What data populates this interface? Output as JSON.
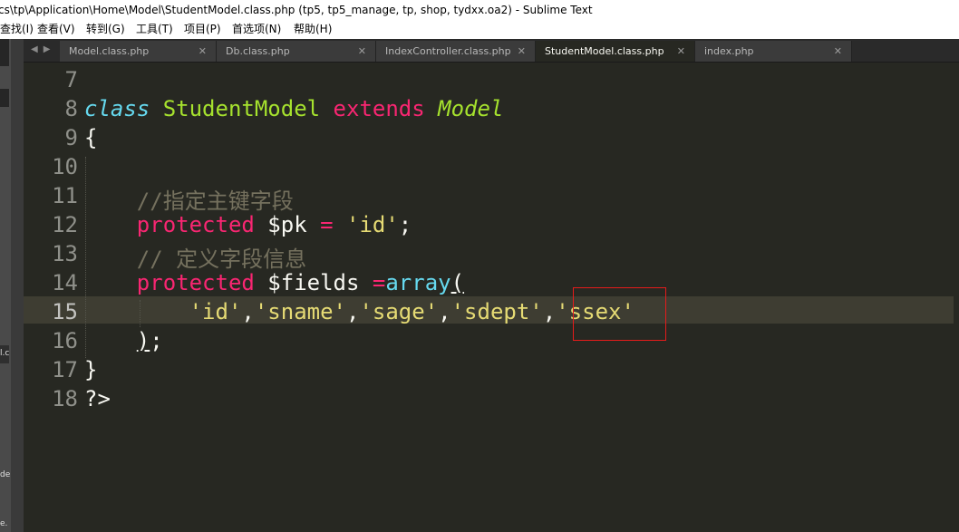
{
  "window": {
    "title": "cs\\tp\\Application\\Home\\Model\\StudentModel.class.php (tp5, tp5_manage, tp, shop, tydxx.oa2) - Sublime Text"
  },
  "menu": [
    "查找(I)",
    "查看(V)",
    "转到(G)",
    "工具(T)",
    "项目(P)",
    "首选项(N)",
    "帮助(H)"
  ],
  "tabs": [
    {
      "label": "Model.class.php",
      "active": false
    },
    {
      "label": "Db.class.php",
      "active": false
    },
    {
      "label": "IndexController.class.php",
      "active": false
    },
    {
      "label": "StudentModel.class.php",
      "active": true
    },
    {
      "label": "index.php",
      "active": false
    }
  ],
  "left_fragments": [
    "l.c",
    "de",
    "e."
  ],
  "highlight": {
    "current_line": 15,
    "box_color": "#e51b1b"
  },
  "colors": {
    "keyword": "#f92672",
    "class_kw": "#66d9ef",
    "class_name": "#a6e22e",
    "string": "#e6db74",
    "comment": "#75715e",
    "default": "#f8f8f2"
  },
  "editor": {
    "lines": [
      {
        "num": "7",
        "tokens": []
      },
      {
        "num": "8",
        "tokens": [
          {
            "t": "class",
            "c": "class_kw",
            "i": true
          },
          {
            "t": " ",
            "c": "default"
          },
          {
            "t": "StudentModel",
            "c": "class_name"
          },
          {
            "t": " ",
            "c": "default"
          },
          {
            "t": "extends",
            "c": "keyword"
          },
          {
            "t": " ",
            "c": "default"
          },
          {
            "t": "Model",
            "c": "class_name",
            "i": true
          }
        ]
      },
      {
        "num": "9",
        "tokens": [
          {
            "t": "{",
            "c": "default"
          }
        ]
      },
      {
        "num": "10",
        "tokens": []
      },
      {
        "num": "11",
        "tokens": [
          {
            "t": "    //指定主键字段",
            "c": "comment"
          }
        ]
      },
      {
        "num": "12",
        "tokens": [
          {
            "t": "    ",
            "c": "default"
          },
          {
            "t": "protected",
            "c": "keyword"
          },
          {
            "t": " $pk ",
            "c": "default"
          },
          {
            "t": "=",
            "c": "keyword"
          },
          {
            "t": " ",
            "c": "default"
          },
          {
            "t": "'id'",
            "c": "string"
          },
          {
            "t": ";",
            "c": "default"
          }
        ]
      },
      {
        "num": "13",
        "tokens": [
          {
            "t": "    // 定义字段信息",
            "c": "comment"
          }
        ]
      },
      {
        "num": "14",
        "tokens": [
          {
            "t": "    ",
            "c": "default"
          },
          {
            "t": "protected",
            "c": "keyword"
          },
          {
            "t": " $fields ",
            "c": "default"
          },
          {
            "t": "=",
            "c": "keyword"
          },
          {
            "t": "array",
            "c": "class_kw"
          },
          {
            "t": "(",
            "c": "default",
            "u": true
          }
        ]
      },
      {
        "num": "15",
        "tokens": [
          {
            "t": "        ",
            "c": "default"
          },
          {
            "t": "'id'",
            "c": "string"
          },
          {
            "t": ",",
            "c": "default"
          },
          {
            "t": "'sname'",
            "c": "string"
          },
          {
            "t": ",",
            "c": "default"
          },
          {
            "t": "'sage'",
            "c": "string"
          },
          {
            "t": ",",
            "c": "default"
          },
          {
            "t": "'sdept'",
            "c": "string"
          },
          {
            "t": ",",
            "c": "default"
          },
          {
            "t": "'ssex'",
            "c": "string"
          }
        ]
      },
      {
        "num": "16",
        "tokens": [
          {
            "t": "    ",
            "c": "default"
          },
          {
            "t": ")",
            "c": "default",
            "u": true
          },
          {
            "t": ";",
            "c": "default"
          }
        ]
      },
      {
        "num": "17",
        "tokens": [
          {
            "t": "}",
            "c": "default"
          }
        ]
      },
      {
        "num": "18",
        "tokens": [
          {
            "t": "?>",
            "c": "default"
          }
        ]
      }
    ]
  }
}
